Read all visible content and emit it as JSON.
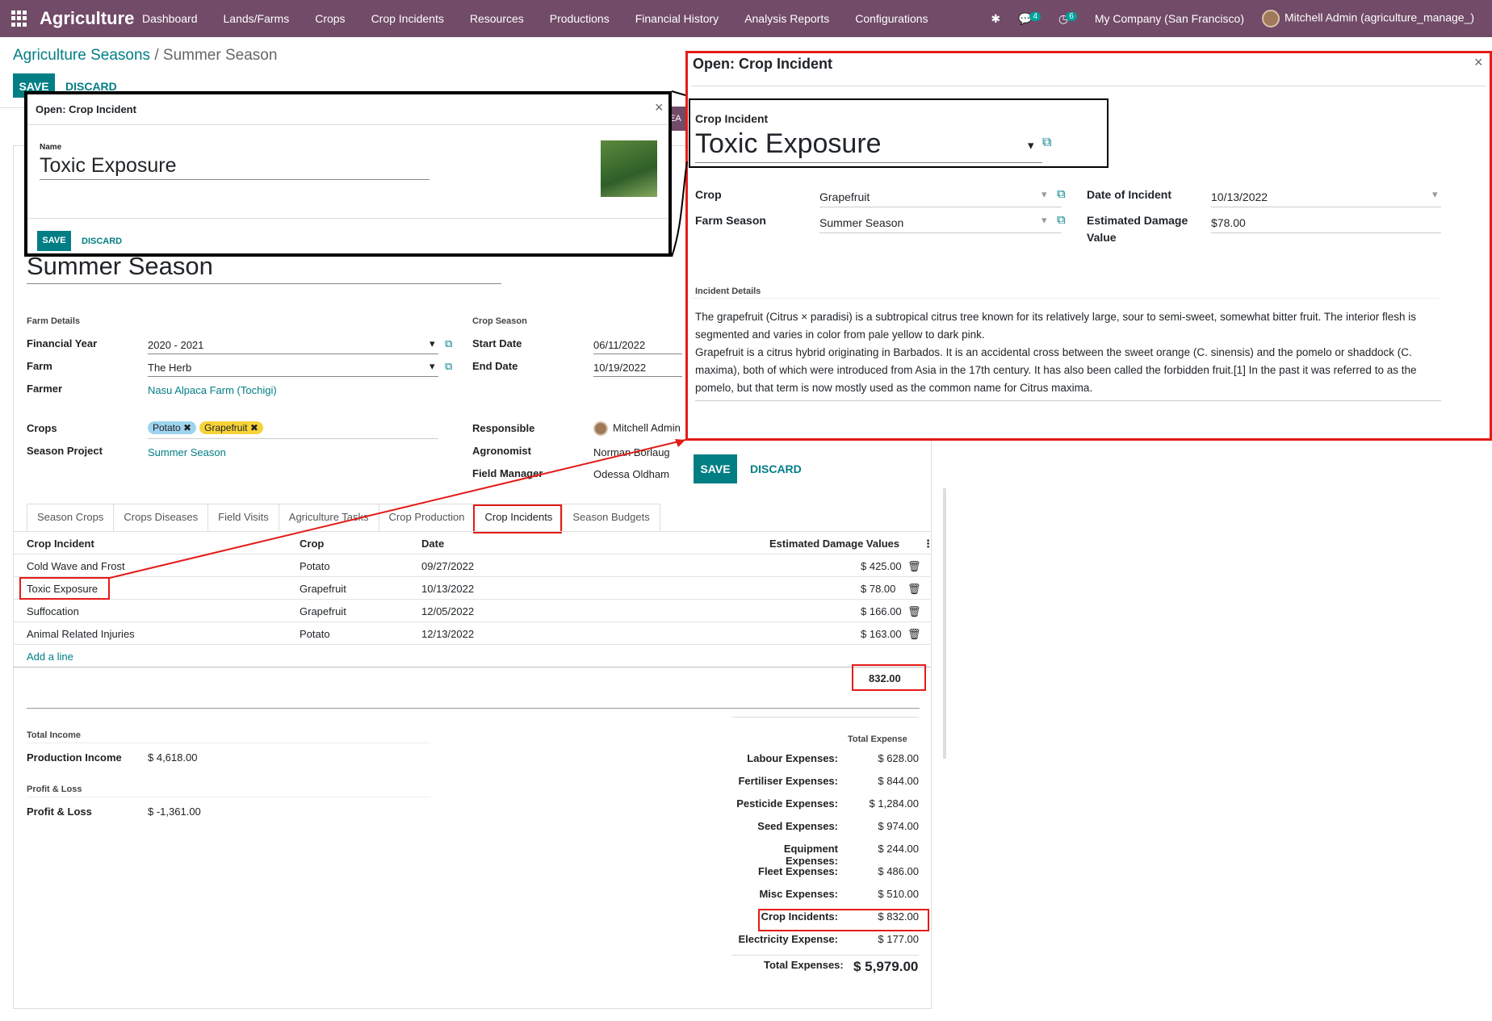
{
  "navbar": {
    "brand": "Agriculture",
    "menu": [
      "Dashboard",
      "Lands/Farms",
      "Crops",
      "Crop Incidents",
      "Resources",
      "Productions",
      "Financial History",
      "Analysis Reports",
      "Configurations"
    ],
    "messages_count": "4",
    "activity_count": "6",
    "company": "My Company (San Francisco)",
    "user": "Mitchell Admin (agriculture_manage_)"
  },
  "breadcrumb": {
    "parent": "Agriculture Seasons",
    "separator": " / ",
    "current": "Summer Season"
  },
  "form": {
    "save": "SAVE",
    "discard": "DISCARD",
    "title": "Summer Season",
    "farm_details": "Farm Details",
    "financial_year_label": "Financial Year",
    "financial_year": "2020 - 2021",
    "farm_label": "Farm",
    "farm": "The Herb",
    "farmer_label": "Farmer",
    "farmer": "Nasu Alpaca Farm (Tochigi)",
    "crop_season": "Crop Season",
    "start_label": "Start Date",
    "start": "06/11/2022",
    "end_label": "End Date",
    "end": "10/19/2022",
    "crops_label": "Crops",
    "crop_tags": [
      "Potato",
      "Grapefruit"
    ],
    "season_project_label": "Season Project",
    "season_project": "Summer Season",
    "responsible_label": "Responsible",
    "responsible": "Mitchell Admin",
    "agronomist_label": "Agronomist",
    "agronomist": "Norman Borlaug",
    "field_manager_label": "Field Manager",
    "field_manager": "Odessa Oldham"
  },
  "tabs": [
    "Season Crops",
    "Crops Diseases",
    "Field Visits",
    "Agriculture Tasks",
    "Crop Production",
    "Crop Incidents",
    "Season Budgets"
  ],
  "table": {
    "headers": [
      "Crop Incident",
      "Crop",
      "Date",
      "Estimated Damage Values"
    ],
    "rows": [
      [
        "Cold Wave and Frost",
        "Potato",
        "09/27/2022",
        "$ 425.00"
      ],
      [
        "Toxic Exposure",
        "Grapefruit",
        "10/13/2022",
        "$ 78.00"
      ],
      [
        "Suffocation",
        "Grapefruit",
        "12/05/2022",
        "$ 166.00"
      ],
      [
        "Animal Related Injuries",
        "Potato",
        "12/13/2022",
        "$ 163.00"
      ]
    ],
    "add_line": "Add a line",
    "total": "832.00"
  },
  "finance": {
    "total_income": "Total Income",
    "production_income_label": "Production Income",
    "production_income": "$ 4,618.00",
    "pl_section": "Profit & Loss",
    "pl_label": "Profit & Loss",
    "pl": "$ -1,361.00",
    "total_expense": "Total Expense",
    "expenses": [
      [
        "Labour Expenses:",
        "$ 628.00"
      ],
      [
        "Fertiliser Expenses:",
        "$ 844.00"
      ],
      [
        "Pesticide Expenses:",
        "$ 1,284.00"
      ],
      [
        "Seed Expenses:",
        "$ 974.00"
      ],
      [
        "Equipment Expenses:",
        "$ 244.00"
      ],
      [
        "Fleet Expenses:",
        "$ 486.00"
      ],
      [
        "Misc Expenses:",
        "$ 510.00"
      ],
      [
        "Crop Incidents:",
        "$ 832.00"
      ],
      [
        "Electricity Expense:",
        "$ 177.00"
      ]
    ],
    "total_label": "Total Expenses:",
    "total": "$ 5,979.00"
  },
  "small_modal": {
    "title": "Open: Crop Incident",
    "name_label": "Name",
    "name": "Toxic Exposure",
    "save": "SAVE",
    "discard": "DISCARD"
  },
  "big_modal": {
    "title": "Open: Crop Incident",
    "incident_label": "Crop Incident",
    "incident": "Toxic Exposure",
    "crop_label": "Crop",
    "crop": "Grapefruit",
    "season_label": "Farm Season",
    "season": "Summer Season",
    "date_label": "Date of Incident",
    "date": "10/13/2022",
    "damage_label_1": "Estimated Damage",
    "damage_label_2": "Value",
    "damage": "$78.00",
    "details_label": "Incident Details",
    "details_p1": "The grapefruit (Citrus × paradisi) is a subtropical citrus tree known for its relatively large, sour to semi-sweet, somewhat bitter fruit. The interior flesh is segmented and varies in color from pale yellow to dark pink.",
    "details_p2": "Grapefruit is a citrus hybrid originating in Barbados. It is an accidental cross between the sweet orange (C. sinensis) and the pomelo or shaddock (C. maxima), both of which were introduced from Asia in the 17th century. It has also been called the forbidden fruit.[1] In the past it was referred to as the pomelo, but that term is now mostly used as the common name for Citrus maxima.",
    "save": "SAVE",
    "discard": "DISCARD"
  },
  "colors": {
    "navbar": "#714b67",
    "primary": "#017e84",
    "highlight": "#e41b17"
  }
}
